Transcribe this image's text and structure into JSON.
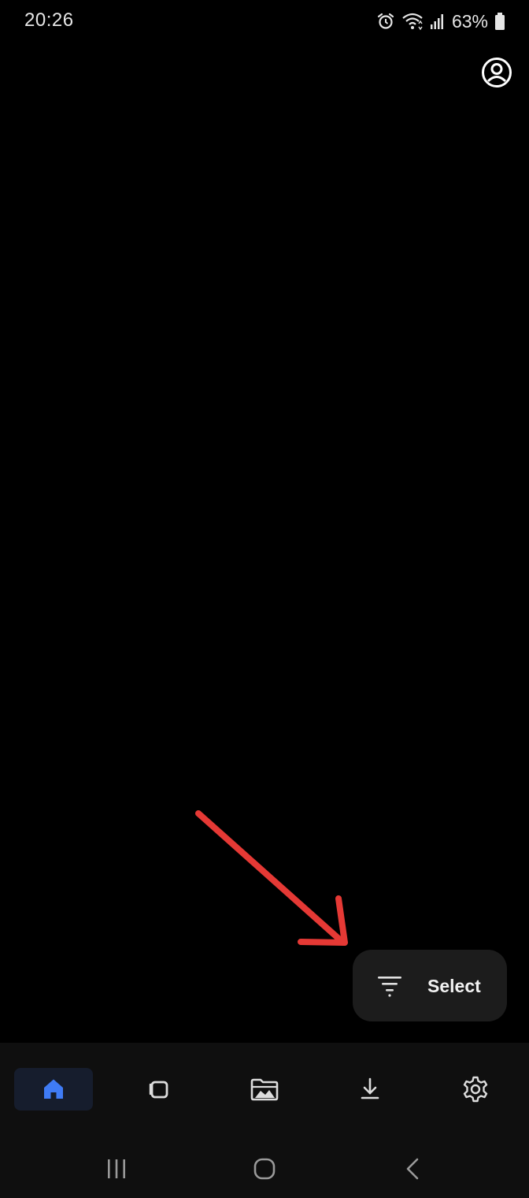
{
  "status_bar": {
    "time": "20:26",
    "battery": "63%",
    "icons": [
      "alarm-icon",
      "wifi-icon",
      "signal-icon",
      "battery-icon"
    ]
  },
  "header": {
    "profile_icon": "account-circle-icon"
  },
  "fab": {
    "label": "Select",
    "icon": "filter-icon"
  },
  "annotation": {
    "color": "#e53935"
  },
  "bottom_nav": {
    "active_color": "#3f7bf5",
    "items": [
      {
        "icon": "home-icon",
        "active": true
      },
      {
        "icon": "tabs-icon",
        "active": false
      },
      {
        "icon": "folder-icon",
        "active": false
      },
      {
        "icon": "download-icon",
        "active": false
      },
      {
        "icon": "gear-icon",
        "active": false
      }
    ]
  },
  "system_nav": {
    "items": [
      "recent-apps-icon",
      "home-circle-icon",
      "back-icon"
    ]
  }
}
